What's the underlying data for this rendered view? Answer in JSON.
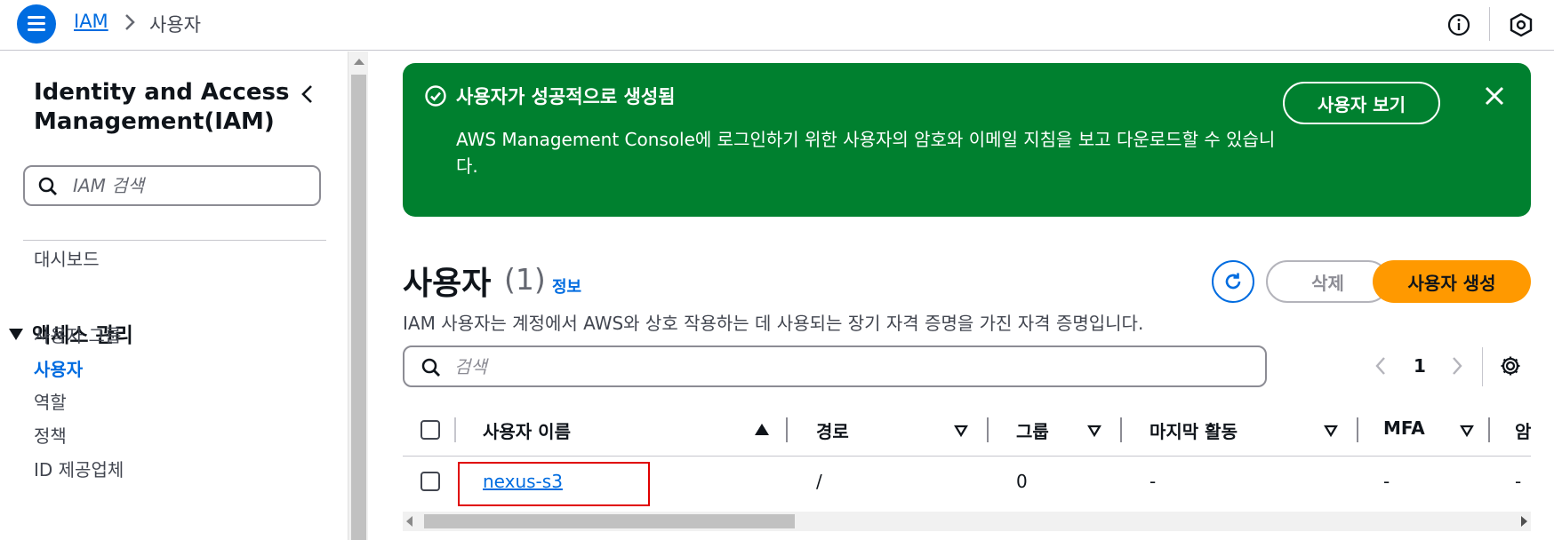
{
  "topbar": {
    "breadcrumb_service": "IAM",
    "breadcrumb_current": "사용자"
  },
  "sidebar": {
    "title": "Identity and Access Management(IAM)",
    "search_placeholder": "IAM 검색",
    "dashboard": "대시보드",
    "section_access": "액세스 관리",
    "items": [
      "사용자 그룹",
      "사용자",
      "역할",
      "정책",
      "ID 제공업체"
    ],
    "active_item": "사용자"
  },
  "flash": {
    "title": "사용자가 성공적으로 생성됨",
    "message": "AWS Management Console에 로그인하기 위한 사용자의 암호와 이메일 지침을 보고 다운로드할 수 있습니다.",
    "view_button": "사용자 보기",
    "color": "#00802f"
  },
  "users": {
    "title": "사용자",
    "count": "(1)",
    "info_link": "정보",
    "description": "IAM 사용자는 계정에서 AWS와 상호 작용하는 데 사용되는 장기 자격 증명을 가진 자격 증명입니다.",
    "delete_button": "삭제",
    "create_button": "사용자 생성",
    "search_placeholder": "검색",
    "page": "1",
    "columns": [
      "사용자 이름",
      "경로",
      "그룹",
      "마지막 활동",
      "MFA",
      "암"
    ],
    "rows": [
      {
        "name": "nexus-s3",
        "path": "/",
        "groups": "0",
        "last_activity": "-",
        "mfa": "-",
        "extra": "-"
      }
    ]
  },
  "colors": {
    "link": "#006ce0",
    "primary_button": "#ff9900",
    "highlight_box": "#e00000"
  }
}
